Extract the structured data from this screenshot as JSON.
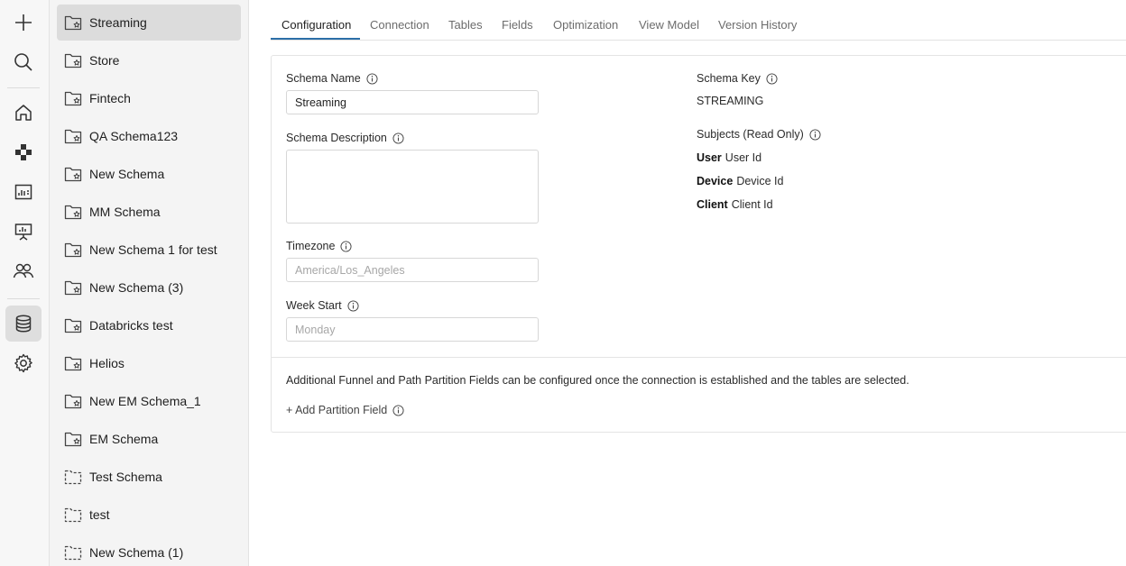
{
  "rail": {
    "icons": [
      "plus-icon",
      "search-icon",
      "home-icon",
      "grid-icon",
      "dashboard-icon",
      "presentation-icon",
      "users-icon",
      "database-icon",
      "gear-icon"
    ]
  },
  "schemas": [
    {
      "label": "Streaming",
      "type": "folder-star",
      "active": true
    },
    {
      "label": "Store",
      "type": "folder-star"
    },
    {
      "label": "Fintech",
      "type": "folder-star"
    },
    {
      "label": "QA Schema123",
      "type": "folder-star"
    },
    {
      "label": "New Schema",
      "type": "folder-star"
    },
    {
      "label": "MM Schema",
      "type": "folder-star"
    },
    {
      "label": "New Schema 1 for test",
      "type": "folder-star"
    },
    {
      "label": "New Schema (3)",
      "type": "folder-star"
    },
    {
      "label": "Databricks test",
      "type": "folder-star"
    },
    {
      "label": "Helios",
      "type": "folder-star"
    },
    {
      "label": "New EM Schema_1",
      "type": "folder-star"
    },
    {
      "label": "EM Schema",
      "type": "folder-star"
    },
    {
      "label": "Test Schema",
      "type": "folder-dashed"
    },
    {
      "label": "test",
      "type": "folder-dashed"
    },
    {
      "label": "New Schema (1)",
      "type": "folder-dashed"
    }
  ],
  "tabs": [
    "Configuration",
    "Connection",
    "Tables",
    "Fields",
    "Optimization",
    "View Model",
    "Version History"
  ],
  "active_tab": "Configuration",
  "form": {
    "schema_name_label": "Schema Name",
    "schema_name_value": "Streaming",
    "schema_description_label": "Schema Description",
    "schema_description_value": "",
    "timezone_label": "Timezone",
    "timezone_placeholder": "America/Los_Angeles",
    "week_start_label": "Week Start",
    "week_start_placeholder": "Monday",
    "schema_key_label": "Schema Key",
    "schema_key_value": "STREAMING",
    "subjects_label": "Subjects (Read Only)",
    "subjects": [
      {
        "name": "User",
        "id": "User Id"
      },
      {
        "name": "Device",
        "id": "Device Id"
      },
      {
        "name": "Client",
        "id": "Client Id"
      }
    ],
    "partition_note": "Additional Funnel and Path Partition Fields can be configured once the connection is established and the tables are selected.",
    "add_partition_label": "+ Add Partition Field"
  },
  "colors": {
    "accent": "#2c6fa8",
    "active_item_bg": "#dcdcdc"
  }
}
